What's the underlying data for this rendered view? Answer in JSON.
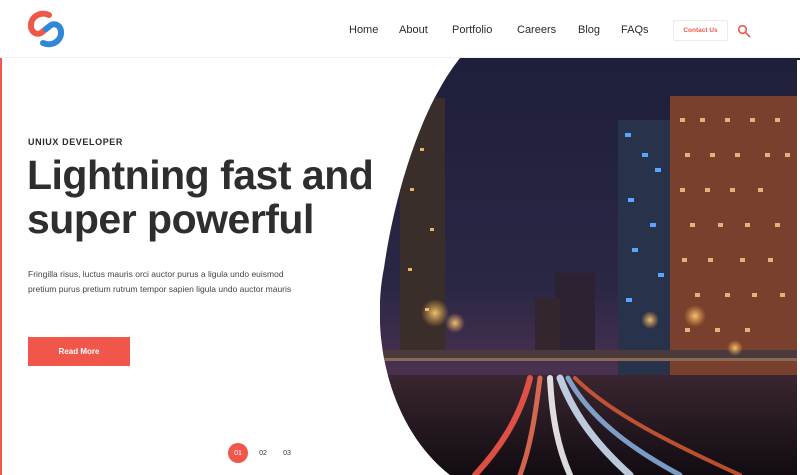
{
  "nav": {
    "items": [
      "Home",
      "About",
      "Portfolio",
      "Careers",
      "Blog",
      "FAQs"
    ],
    "contact_label": "Contact Us"
  },
  "hero": {
    "eyebrow": "UNIUX DEVELOPER",
    "headline_line1": "Lightning fast and",
    "headline_line2": "super powerful",
    "body": "Fringilla risus, luctus mauris orci auctor purus a ligula undo euismod pretium purus pretium rutrum tempor sapien ligula undo auctor mauris",
    "cta_label": "Read More"
  },
  "pagination": {
    "pages": [
      "01",
      "02",
      "03"
    ],
    "active_index": 0
  },
  "icons": {
    "logo": "logo-icon",
    "search": "search-icon"
  },
  "colors": {
    "accent": "#f0564a",
    "secondary_accent": "#2f87d8",
    "text_dark": "#2e2e2e"
  }
}
